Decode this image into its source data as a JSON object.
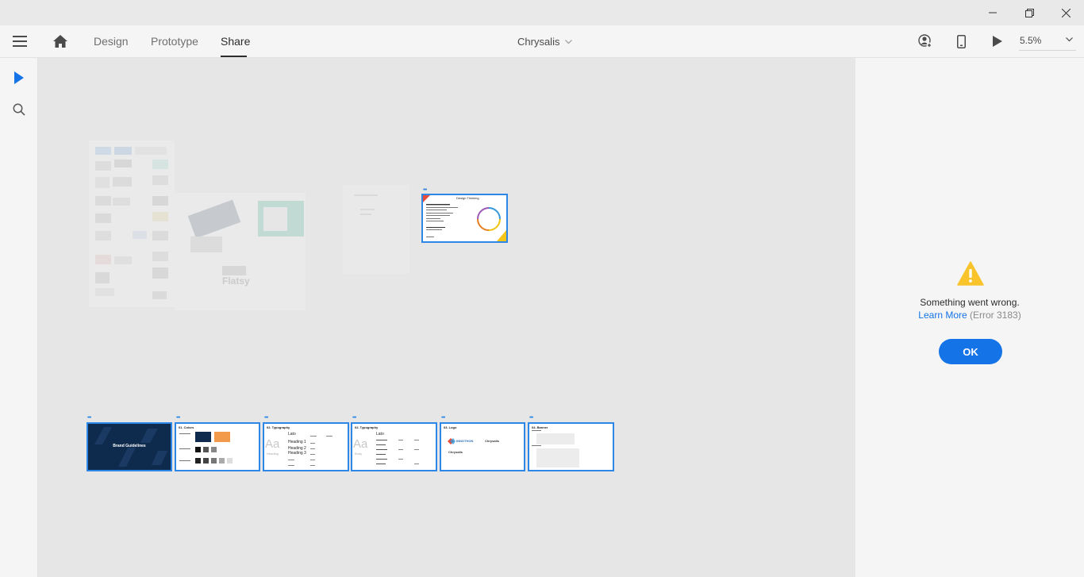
{
  "window": {
    "controls": [
      "minimize",
      "restore",
      "close"
    ]
  },
  "appbar": {
    "tabs": [
      {
        "label": "Design",
        "active": false
      },
      {
        "label": "Prototype",
        "active": false
      },
      {
        "label": "Share",
        "active": true
      }
    ],
    "document_title": "Chrysalis",
    "zoom": "5.5%"
  },
  "artboards": {
    "top": {
      "title": "Design Thinking"
    },
    "row": [
      {
        "label": "",
        "title": "Brand Guidelines"
      },
      {
        "label": "01. Colors"
      },
      {
        "label": "02. Typography",
        "big_text": "Aa",
        "sub": "Heading"
      },
      {
        "label": "02. Typography",
        "big_text": "Aa",
        "sub": "Body"
      },
      {
        "label": "03. Logo",
        "logo_a": "INNOTHON",
        "logo_b": "Chrysalis",
        "logo_c": "Chrysalis"
      },
      {
        "label": "04. Banner"
      }
    ],
    "typography_sample": {
      "font": "Lato",
      "lines": [
        "Heading 1",
        "Heading 2",
        "Heading 3"
      ]
    }
  },
  "error_panel": {
    "message": "Something went wrong.",
    "link": "Learn More",
    "code": "(Error 3183)",
    "button": "OK"
  },
  "colors": {
    "accent": "#1473e6",
    "artboard_border": "#2d87e6",
    "warning": "#f8c32b",
    "navy": "#0e2b4e",
    "orange": "#f2994a"
  },
  "icons": [
    "hamburger-icon",
    "home-icon",
    "chevron-down-icon",
    "user-share-icon",
    "device-icon",
    "play-icon",
    "select-arrow-icon",
    "search-icon",
    "warning-icon"
  ]
}
